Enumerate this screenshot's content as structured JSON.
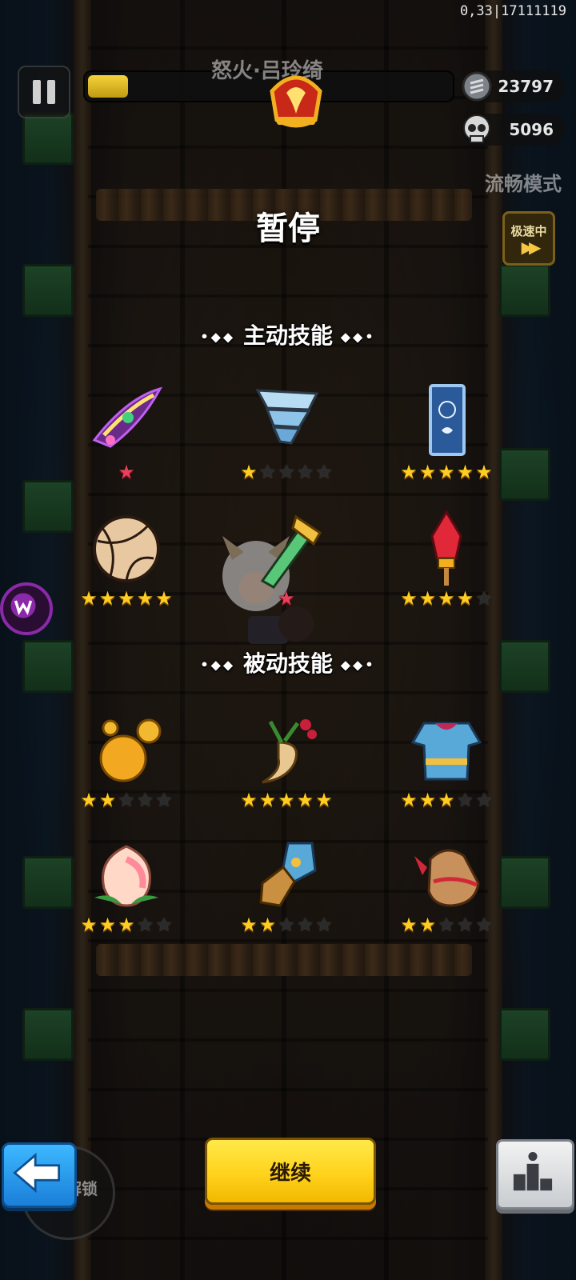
{
  "hud": {
    "coords": "0,33|17111119",
    "boss_name": "怒火·吕玲绮",
    "boss_hp_fraction": 0.11,
    "coins": "23797",
    "kills": "5096",
    "smooth_mode": "流畅模式",
    "speed_mode": "极速中",
    "speed_arrows": "▶▶"
  },
  "pause": {
    "title": "暂停",
    "active_title": "主动技能",
    "passive_title": "被动技能",
    "deco_left": "•◆◆",
    "deco_right": "◆◆•"
  },
  "skills": {
    "active": [
      {
        "icon": "cursed-blade-icon",
        "stars": 1,
        "max": 1,
        "style": "red"
      },
      {
        "icon": "tornado-icon",
        "stars": 1,
        "max": 5,
        "style": "gold"
      },
      {
        "icon": "fire-talisman-icon",
        "stars": 5,
        "max": 5,
        "style": "gold"
      },
      {
        "icon": "volleyball-icon",
        "stars": 5,
        "max": 5,
        "style": "gold"
      },
      {
        "icon": "jade-ruyi-icon",
        "stars": 1,
        "max": 1,
        "style": "red"
      },
      {
        "icon": "firework-rocket-icon",
        "stars": 4,
        "max": 5,
        "style": "gold"
      }
    ],
    "passive": [
      {
        "icon": "golden-orbs-icon",
        "stars": 2,
        "max": 5,
        "style": "gold"
      },
      {
        "icon": "ginseng-icon",
        "stars": 5,
        "max": 5,
        "style": "gold"
      },
      {
        "icon": "armor-icon",
        "stars": 3,
        "max": 5,
        "style": "gold"
      },
      {
        "icon": "peach-icon",
        "stars": 3,
        "max": 5,
        "style": "gold"
      },
      {
        "icon": "gauntlet-icon",
        "stars": 2,
        "max": 5,
        "style": "gold"
      },
      {
        "icon": "loot-bag-icon",
        "stars": 2,
        "max": 5,
        "style": "gold"
      }
    ]
  },
  "buttons": {
    "continue": "继续",
    "unlock": "解锁"
  },
  "colors": {
    "star_gold": "#ffcc22",
    "star_red": "#e8405a",
    "continue_bg": "#ffd21c",
    "back_bg": "#2a9cf0"
  }
}
